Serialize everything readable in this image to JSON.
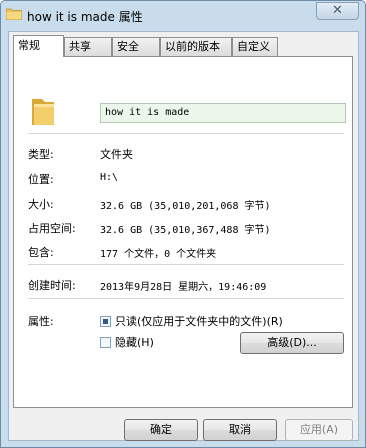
{
  "window": {
    "title": "how it is made 属性",
    "close_glyph": "✕"
  },
  "tabs": [
    {
      "label": "常规",
      "active": true
    },
    {
      "label": "共享"
    },
    {
      "label": "安全"
    },
    {
      "label": "以前的版本"
    },
    {
      "label": "自定义"
    }
  ],
  "general": {
    "folder_name": "how it is made",
    "rows": {
      "type": {
        "label": "类型:",
        "value": "文件夹"
      },
      "location": {
        "label": "位置:",
        "value": "H:\\"
      },
      "size": {
        "label": "大小:",
        "value": "32.6 GB (35,010,201,068 字节)"
      },
      "size_on_disk": {
        "label": "占用空间:",
        "value": "32.6 GB (35,010,367,488 字节)"
      },
      "contains": {
        "label": "包含:",
        "value": "177 个文件，0 个文件夹"
      },
      "created": {
        "label": "创建时间:",
        "value": "2013年9月28日 星期六，19:46:09"
      }
    },
    "attributes": {
      "label": "属性:",
      "readonly": {
        "label": "只读(仅应用于文件夹中的文件)(R)",
        "state": "indeterminate"
      },
      "hidden": {
        "label": "隐藏(H)",
        "checked": false
      },
      "advanced_label": "高级(D)..."
    }
  },
  "footer": {
    "ok_label": "确定",
    "cancel_label": "取消",
    "apply_label": "应用(A)"
  },
  "colors": {
    "frame": "#c9dcec",
    "name_field": "#ecf7ec",
    "checkbox_fill": "#2d5c8a"
  }
}
